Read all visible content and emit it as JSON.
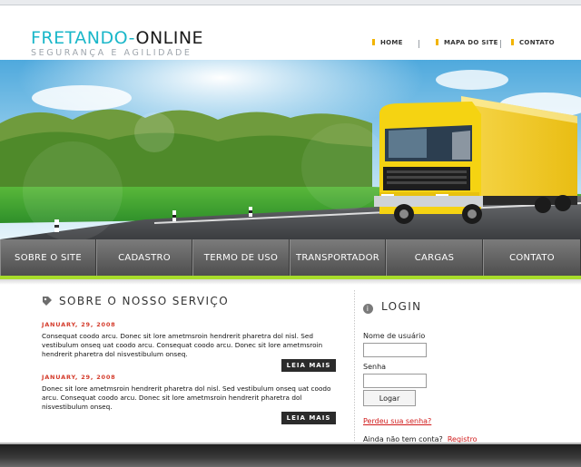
{
  "logo": {
    "part1": "FRETANDO-",
    "part2": "ONLINE",
    "tagline": "SEGURANÇA E AGILIDADE"
  },
  "topnav": {
    "items": [
      "HOME",
      "MAPA DO SITE",
      "CONTATO"
    ]
  },
  "mainnav": {
    "items": [
      "SOBRE O SITE",
      "CADASTRO",
      "TERMO DE USO",
      "TRANSPORTADOR",
      "CARGAS",
      "CONTATO"
    ]
  },
  "main": {
    "title": "SOBRE O NOSSO SERVIÇO",
    "news": [
      {
        "date": "JANUARY, 29, 2008",
        "text": "Consequat coodo arcu. Donec sit lore ametmsroin hendrerit pharetra dol nisl. Sed vestibulum onseq uat coodo arcu. Consequat coodo arcu. Donec sit lore ametmsroin hendrerit pharetra dol nisvestibulum onseq.",
        "button": "LEIA MAIS"
      },
      {
        "date": "JANUARY, 29, 2008",
        "text": "Donec sit lore ametmsroin hendrerit pharetra dol nisl. Sed vestibulum onseq uat coodo arcu. Consequat coodo arcu. Donec sit lore ametmsroin hendrerit pharetra dol nisvestibulum onseq.",
        "button": "LEIA MAIS"
      }
    ]
  },
  "login": {
    "title": "LOGIN",
    "user_label": "Nome de usuário",
    "password_label": "Senha",
    "button": "Logar",
    "forgot": "Perdeu sua senha?",
    "no_account": "Ainda não tem conta?",
    "register": "Registro"
  },
  "colors": {
    "accent": "#1ab7c9",
    "nav_green": "#a7dc2a",
    "date_red": "#d43a2a",
    "truck_yellow": "#f5d312"
  },
  "icons": {
    "section": "tag-icon",
    "login": "info-circle-icon",
    "bullet": "yellow-bullet-icon"
  }
}
